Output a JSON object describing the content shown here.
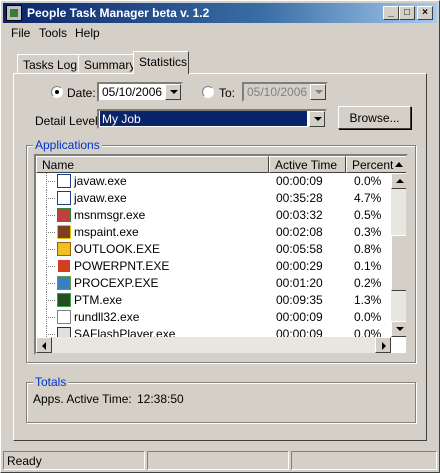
{
  "window": {
    "title": "People Task Manager  beta v. 1.2",
    "minimize_glyph": "_",
    "maximize_glyph": "□",
    "close_glyph": "×"
  },
  "menu": [
    "File",
    "Tools",
    "Help"
  ],
  "tabs": [
    "Tasks Log",
    "Summary",
    "Statistics"
  ],
  "active_tab": "Statistics",
  "filters": {
    "date_label": "Date:",
    "date_value": "05/10/2006",
    "date_checked": true,
    "to_label": "To:",
    "to_value": "05/10/2006",
    "to_checked": false,
    "detail_label": "Detail Level:",
    "detail_value": "My Job",
    "browse_label": "Browse..."
  },
  "applications": {
    "title": "Applications",
    "columns": [
      "Name",
      "Active Time",
      "Percent"
    ],
    "rows": [
      {
        "name": "javaw.exe",
        "time": "00:00:09",
        "percent": "0.0%",
        "icon": "window-icon"
      },
      {
        "name": "javaw.exe",
        "time": "00:35:28",
        "percent": "4.7%",
        "icon": "window-icon"
      },
      {
        "name": "msnmsgr.exe",
        "time": "00:03:32",
        "percent": "0.5%",
        "icon": "messenger-icon"
      },
      {
        "name": "mspaint.exe",
        "time": "00:02:08",
        "percent": "0.3%",
        "icon": "paint-icon"
      },
      {
        "name": "OUTLOOK.EXE",
        "time": "00:05:58",
        "percent": "0.8%",
        "icon": "outlook-icon"
      },
      {
        "name": "POWERPNT.EXE",
        "time": "00:00:29",
        "percent": "0.1%",
        "icon": "powerpoint-icon"
      },
      {
        "name": "PROCEXP.EXE",
        "time": "00:01:20",
        "percent": "0.2%",
        "icon": "process-explorer-icon"
      },
      {
        "name": "PTM.exe",
        "time": "00:09:35",
        "percent": "1.3%",
        "icon": "ptm-icon"
      },
      {
        "name": "rundll32.exe",
        "time": "00:00:09",
        "percent": "0.0%",
        "icon": "document-icon"
      },
      {
        "name": "SAFlashPlayer.exe",
        "time": "00:00:09",
        "percent": "0.0%",
        "icon": "flash-icon"
      }
    ]
  },
  "totals": {
    "title": "Totals",
    "label": "Apps. Active Time:",
    "value": "12:38:50"
  },
  "status": {
    "text": "Ready"
  }
}
